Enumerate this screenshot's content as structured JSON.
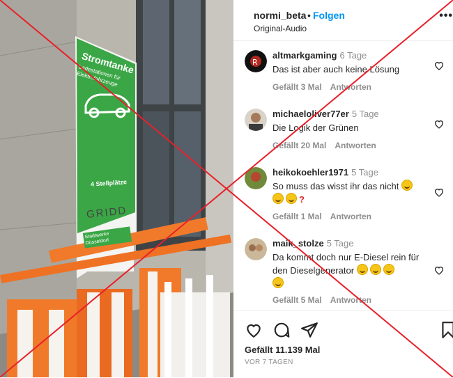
{
  "post": {
    "username": "normi_beta",
    "separator": "•",
    "follow_label": "Folgen",
    "audio": "Original-Audio",
    "more_label": "•••"
  },
  "photo": {
    "sign_title": "Stromtanke",
    "sign_subtitle": "Ladestationen für Elektrofahrzeuge",
    "sign_spots": "4 Stellplätze",
    "sign_brand": "GRIDD",
    "sign_operator": "Stadtwerke Düsseldorf",
    "sign_color": "#3aa645"
  },
  "comments": [
    {
      "user": "altmarkgaming",
      "time": "6 Tage",
      "text": "Das ist aber auch keine Lösung",
      "likes": "Gefällt 3 Mal",
      "reply": "Antworten"
    },
    {
      "user": "michaeloliver77er",
      "time": "5 Tage",
      "text": "Die Logik der Grünen",
      "likes": "Gefällt 20 Mal",
      "reply": "Antworten"
    },
    {
      "user": "heikokoehler1971",
      "time": "5 Tage",
      "text": "So muss das wisst ihr das nicht",
      "likes": "Gefällt 1 Mal",
      "reply": "Antworten"
    },
    {
      "user": "maik_stolze",
      "time": "5 Tage",
      "text": "Da kommt doch nur E-Diesel rein für den Dieselgenerator",
      "likes": "Gefällt 5 Mal",
      "reply": "Antworten"
    }
  ],
  "footer": {
    "likes": "Gefällt 11.139 Mal",
    "date": "VOR 7 TAGEN"
  },
  "icons": {
    "like": "heart-icon",
    "comment": "comment-icon",
    "share": "share-icon",
    "save": "bookmark-icon"
  },
  "colors": {
    "follow": "#0095f6",
    "cross": "#e8202a",
    "secondary_text": "#8e8e8e"
  }
}
